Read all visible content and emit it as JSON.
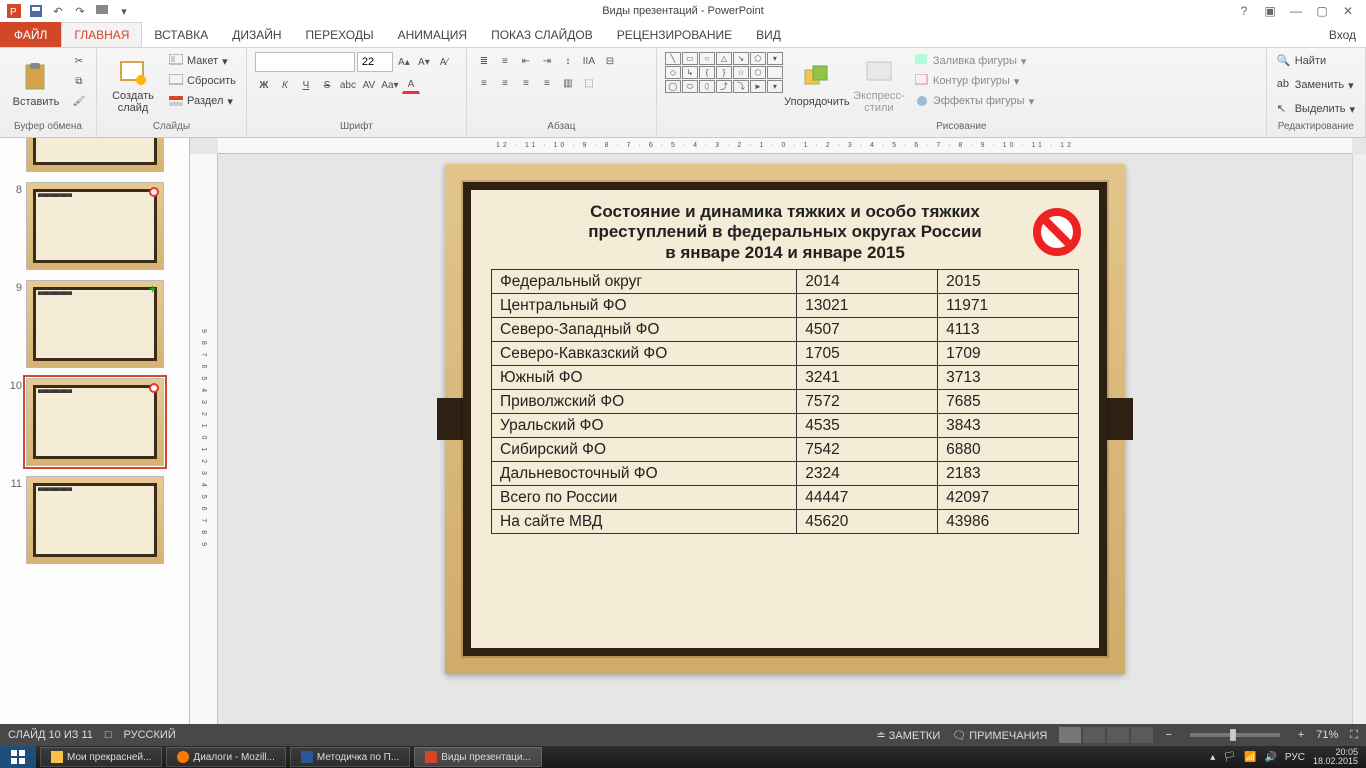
{
  "titlebar": {
    "title": "Виды презентаций - PowerPoint"
  },
  "menubar": {
    "file": "ФАЙЛ",
    "tabs": [
      "ГЛАВНАЯ",
      "ВСТАВКА",
      "ДИЗАЙН",
      "ПЕРЕХОДЫ",
      "АНИМАЦИЯ",
      "ПОКАЗ СЛАЙДОВ",
      "РЕЦЕНЗИРОВАНИЕ",
      "ВИД"
    ],
    "signin": "Вход"
  },
  "ribbon": {
    "clipboard": {
      "paste": "Вставить",
      "title": "Буфер обмена"
    },
    "slides": {
      "new_slide": "Создать слайд",
      "layout": "Макет",
      "reset": "Сбросить",
      "section": "Раздел",
      "title": "Слайды"
    },
    "font": {
      "size": "22",
      "title": "Шрифт",
      "labels": {
        "bold": "Ж",
        "italic": "К",
        "underline": "Ч",
        "strike": "S",
        "spacing": "abc",
        "case": "AV"
      }
    },
    "paragraph": {
      "title": "Абзац"
    },
    "drawing": {
      "arrange": "Упорядочить",
      "quick_styles": "Экспресс-стили",
      "fill": "Заливка фигуры",
      "outline": "Контур фигуры",
      "effects": "Эффекты фигуры",
      "title": "Рисование"
    },
    "editing": {
      "find": "Найти",
      "replace": "Заменить",
      "select": "Выделить",
      "title": "Редактирование"
    }
  },
  "ruler_h": "12 · 11 · 10 · 9 · 8 · 7 · 6 · 5 · 4 · 3 · 2 · 1 · 0 · 1 · 2 · 3 · 4 · 5 · 6 · 7 · 8 · 9 · 10 · 11 · 12",
  "ruler_v": "9 8 7 6 5 4 3 2 1 0 1 2 3 4 5 6 7 8 9",
  "thumbs": [
    {
      "num": "8",
      "marker": "no"
    },
    {
      "num": "9",
      "marker": "plus"
    },
    {
      "num": "10",
      "marker": "no",
      "active": true
    },
    {
      "num": "11",
      "marker": ""
    }
  ],
  "slide": {
    "title_l1": "Состояние и динамика тяжких и особо тяжких",
    "title_l2": "преступлений в федеральных округах России",
    "title_l3": "в январе 2014 и январе 2015",
    "header": [
      "Федеральный округ",
      "2014",
      "2015"
    ],
    "rows": [
      [
        "Центральный ФО",
        "13021",
        "11971"
      ],
      [
        "Северо-Западный ФО",
        "4507",
        "4113"
      ],
      [
        "Северо-Кавказский ФО",
        "1705",
        "1709"
      ],
      [
        "Южный ФО",
        "3241",
        "3713"
      ],
      [
        "Приволжский ФО",
        "7572",
        "7685"
      ],
      [
        "Уральский ФО",
        "4535",
        "3843"
      ],
      [
        "Сибирский ФО",
        "7542",
        "6880"
      ],
      [
        "Дальневосточный ФО",
        "2324",
        "2183"
      ],
      [
        "Всего по России",
        "44447",
        "42097"
      ],
      [
        "На сайте МВД",
        "45620",
        "43986"
      ]
    ]
  },
  "statusbar": {
    "slide_of": "СЛАЙД 10 ИЗ 11",
    "lang": "РУССКИЙ",
    "notes": "ЗАМЕТКИ",
    "comments": "ПРИМЕЧАНИЯ",
    "zoom": "71%"
  },
  "taskbar": {
    "items": [
      "Мои прекрасней...",
      "Диалоги - Mozill...",
      "Методичка по П...",
      "Виды презентаци..."
    ],
    "ime": "РУС",
    "time": "20:05",
    "date": "18.02.2015"
  },
  "chart_data": {
    "type": "table",
    "title": "Состояние и динамика тяжких и особо тяжких преступлений в федеральных округах России в январе 2014 и январе 2015",
    "columns": [
      "Федеральный округ",
      "2014",
      "2015"
    ],
    "rows": [
      {
        "region": "Центральный ФО",
        "2014": 13021,
        "2015": 11971
      },
      {
        "region": "Северо-Западный ФО",
        "2014": 4507,
        "2015": 4113
      },
      {
        "region": "Северо-Кавказский ФО",
        "2014": 1705,
        "2015": 1709
      },
      {
        "region": "Южный ФО",
        "2014": 3241,
        "2015": 3713
      },
      {
        "region": "Приволжский ФО",
        "2014": 7572,
        "2015": 7685
      },
      {
        "region": "Уральский ФО",
        "2014": 4535,
        "2015": 3843
      },
      {
        "region": "Сибирский ФО",
        "2014": 7542,
        "2015": 6880
      },
      {
        "region": "Дальневосточный ФО",
        "2014": 2324,
        "2015": 2183
      },
      {
        "region": "Всего по России",
        "2014": 44447,
        "2015": 42097
      },
      {
        "region": "На сайте МВД",
        "2014": 45620,
        "2015": 43986
      }
    ]
  }
}
